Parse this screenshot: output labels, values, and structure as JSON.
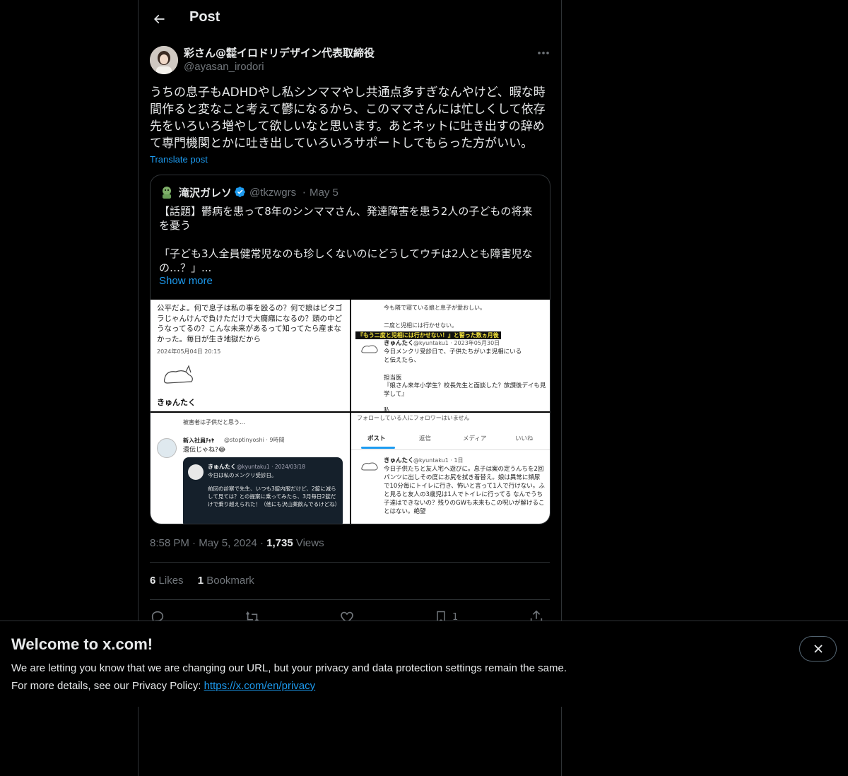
{
  "header": {
    "title": "Post",
    "back_icon": "arrow-left-icon"
  },
  "post": {
    "author_name": "彩さん@㍿イロドリデザイン代表取締役",
    "author_handle": "@ayasan_irodori",
    "text": "うちの息子もADHDやし私シンママやし共通点多すぎなんやけど、暇な時間作ると変なこと考えて鬱になるから、このママさんには忙しくして依存先をいろいろ増やして欲しいなと思います。あとネットに吐き出すの辞めて専門機関とかに吐き出していろいろサポートしてもらった方がいい。",
    "translate_label": "Translate post",
    "time": "8:58 PM",
    "date": "May 5, 2024",
    "views_count": "1,735",
    "views_label": "Views",
    "likes_count": "6",
    "likes_label": "Likes",
    "bookmarks_count": "1",
    "bookmarks_label": "Bookmark",
    "action_bookmark_count": "1"
  },
  "quote": {
    "author_name": "滝沢ガレソ",
    "author_handle": "@tkzwgrs",
    "separator": "·",
    "date": "May 5",
    "line1": "【話題】鬱病を患って8年のシンママさん、発達障害を患う2人の子どもの将来を憂う",
    "line2": "「子ども3人全員健常児なのも珍しくないのにどうしてウチは2人とも障害児なの…？」...",
    "show_more": "Show more",
    "media": {
      "m1_text": "公平だよ。何で息子は私の事を殴るの？何で娘はピタゴラじゃんけんで負けただけで大癇癪になるの？頭の中どうなってるの？こんな未来があるって知ってたら産まなかった。毎日が生き地獄だから",
      "m1_date": "2024年05月04日 20:15",
      "m1_sign": "きゅんたく",
      "m2_top1": "今も隣で寝ている娘と息子が愛おしい。",
      "m2_top2": "二度と児相には行かせない。",
      "m2_banner": "『もう二度と児相には行かせない！』と誓った数ヵ月後",
      "m2_name": "きゅんたく",
      "m2_handle": "@kyuntaku1 · 2023年05月30日",
      "m2_body": "今日メンクリ受診日で、子供たちがいま児相にいると伝えたら、",
      "m2_doc": "担当医",
      "m2_quote": "『娘さん来年小学生？校長先生と面談した？放課後デイも見学して』",
      "m2_tail": "私",
      "m3_top": "被害者は子供だと思う...",
      "m3_name": "新入社員ﾁｬﾔ",
      "m3_handle": "@stoptinyoshi · 9時間",
      "m3_text": "遺伝じゃね?😂",
      "m3_inner_name": "きゅんたく",
      "m3_inner_handle": "@kyuntaku1 · 2024/03/18",
      "m3_inner_line1": "今日は私のメンクリ受診日。",
      "m3_inner_line2": "前回の診察で先生、いつも3錠内服だけど、2錠に減らして見ては？との提案に乗ってみたら、3月毎日2錠だけで乗り越えられた！（他にも沢山薬飲んでるけどね）",
      "m4_top": "フォローしている人にフォロワーはいません",
      "m4_tab1": "ポスト",
      "m4_tab2": "返信",
      "m4_tab3": "メディア",
      "m4_tab4": "いいね",
      "m4_name": "きゅんたく",
      "m4_handle": "@kyuntaku1 · 1日",
      "m4_body": "今日子供たちと友人宅へ遊びに。息子は案の定うんちを2回パンツに出しその度にお尻を拭き着替え。娘は異常に頻尿で10分毎にトイレに行き、怖いと言って1人で行けない。ふと見ると友人の3歳児は1人でトイレに行ってる なんでうち子達はできないの？残りのGWも未来もこの呪いが解けることはない。絶望"
    }
  },
  "banner": {
    "title": "Welcome to x.com!",
    "line1": "We are letting you know that we are changing our URL, but your privacy and data protection settings remain the same.",
    "line2_prefix": "For more details, see our Privacy Policy: ",
    "link": "https://x.com/en/privacy",
    "close_icon": "close-icon"
  },
  "colors": {
    "accent": "#1d9bf0",
    "background": "#000000",
    "border": "#2f3336",
    "muted": "#71767b"
  }
}
